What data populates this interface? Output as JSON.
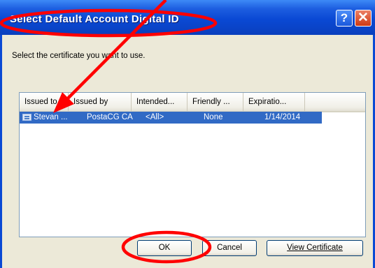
{
  "dialog": {
    "title": "Select Default Account Digital ID",
    "help_glyph": "?",
    "close_glyph": "✕",
    "prompt": "Select the certificate you want to use."
  },
  "list": {
    "columns": [
      {
        "label": "Issued to"
      },
      {
        "label": "Issued by"
      },
      {
        "label": "Intended..."
      },
      {
        "label": "Friendly ..."
      },
      {
        "label": "Expiratio..."
      }
    ],
    "rows": [
      {
        "issued_to": "Stevan ...",
        "issued_by": "PostaCG CA",
        "intended": "<All>",
        "friendly": "None",
        "expiration": "1/14/2014",
        "selected": true
      }
    ]
  },
  "buttons": {
    "ok": "OK",
    "cancel": "Cancel",
    "view_certificate": "View Certificate"
  },
  "colors": {
    "annotation": "#ff0000",
    "selection": "#316ac5",
    "titlebar": "#0a49d4"
  }
}
